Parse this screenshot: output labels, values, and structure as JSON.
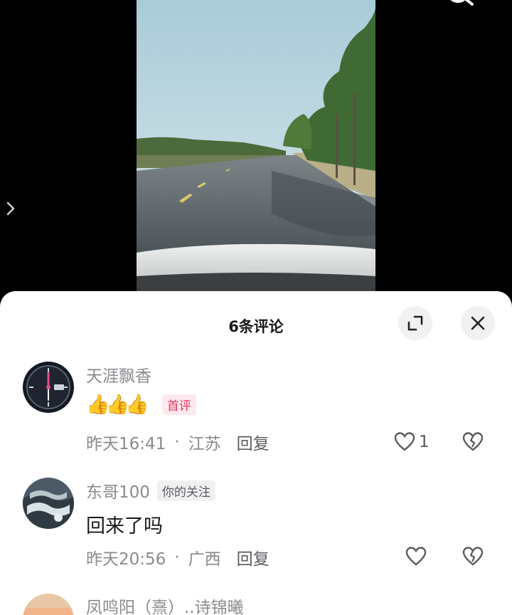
{
  "header": {
    "search_icon": "search-icon",
    "side_arrow_icon": "chevron-right-icon"
  },
  "sheet": {
    "title": "6条评论",
    "expand_icon": "expand-icon",
    "close_icon": "close-icon"
  },
  "comments": [
    {
      "username": "天涯飘香",
      "badge": "首评",
      "emoji": "👍👍👍",
      "time": "昨天16:41",
      "location": "江苏",
      "reply": "回复",
      "likes": "1"
    },
    {
      "username": "东哥100",
      "badge": "你的关注",
      "text": "回来了吗",
      "time": "昨天20:56",
      "location": "广西",
      "reply": "回复",
      "likes": ""
    },
    {
      "username": "凤鸣阳（熹）..诗锦曦"
    }
  ],
  "colors": {
    "accent_red": "#e8365a",
    "sheet_bg": "#ffffff",
    "muted_text": "#8a8a8f"
  }
}
